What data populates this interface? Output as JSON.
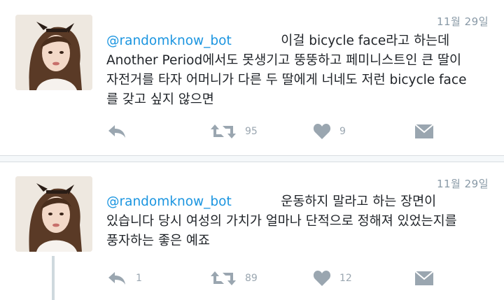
{
  "tweets": [
    {
      "date": "11월 29일",
      "mention": "@randomknow_bot",
      "first_line_rest": "이걸 bicycle face라고 하는데",
      "lines": [
        "Another Period에서도 못생기고 뚱뚱하고 페미니스트인 큰 딸이",
        "자전거를 타자 어머니가 다른 두 딸에게 너네도 저런 bicycle face",
        "를 갖고 싶지 않으면"
      ],
      "actions": {
        "reply_count": "",
        "retweet_count": "95",
        "like_count": "9"
      }
    },
    {
      "date": "11월 29일",
      "mention": "@randomknow_bot",
      "first_line_rest": "운동하지 말라고 하는 장면이",
      "lines": [
        "있습니다 당시 여성의 가치가 얼마나 단적으로 정해져 있었는지를",
        "풍자하는 좋은 예죠"
      ],
      "actions": {
        "reply_count": "1",
        "retweet_count": "89",
        "like_count": "12"
      }
    }
  ],
  "colors": {
    "mention": "#1b95e0",
    "icon": "#9aa6b0",
    "text": "#1f2328",
    "date": "#8899a6"
  },
  "icons": {
    "reply": "reply-arrow-icon",
    "retweet": "retweet-icon",
    "like": "heart-icon",
    "dm": "envelope-icon"
  }
}
